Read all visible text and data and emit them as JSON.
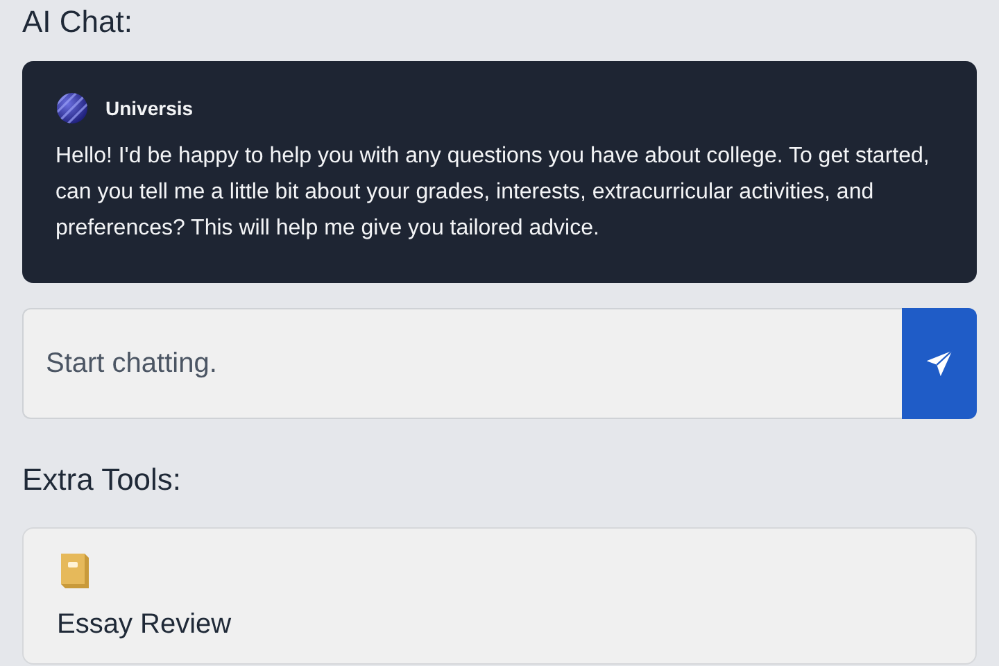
{
  "chat_heading": "AI Chat:",
  "message": {
    "sender": "Universis",
    "text": "Hello! I'd be happy to help you with any questions you have about college. To get started, can you tell me a little bit about your grades, interests, extracurricular activities, and preferences? This will help me give you tailored advice."
  },
  "chat_input": {
    "placeholder": "Start chatting."
  },
  "tools_heading": "Extra Tools:",
  "tools": [
    {
      "title": "Essay Review"
    }
  ]
}
